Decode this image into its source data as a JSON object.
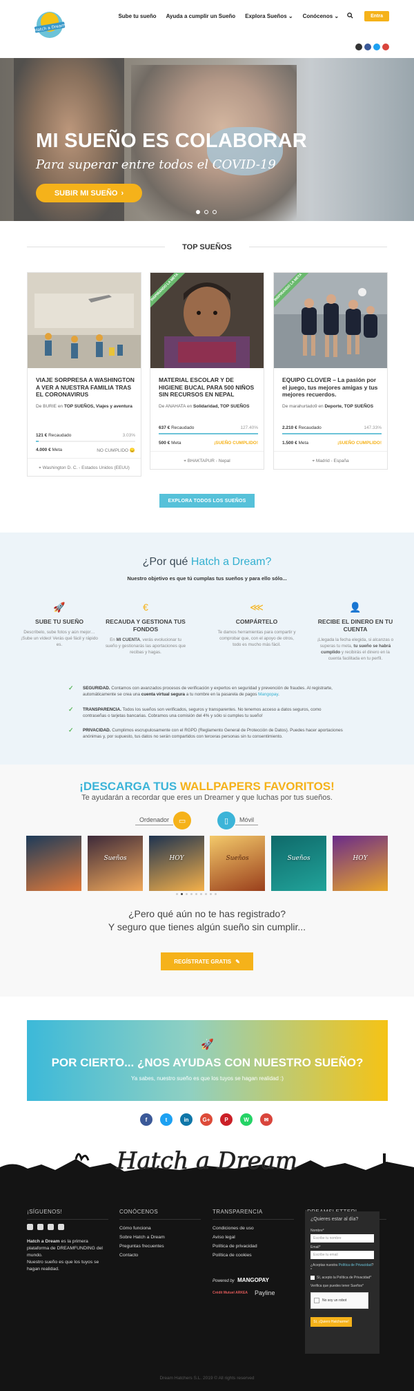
{
  "header": {
    "logo_text": "Hatch a Dream",
    "nav": [
      {
        "label": "Sube tu sueño"
      },
      {
        "label": "Ayuda a cumplir un Sueño"
      },
      {
        "label": "Explora Sueños"
      },
      {
        "label": "Conócenos"
      }
    ],
    "login_label": "Entra",
    "social": [
      "instagram-icon",
      "facebook-icon",
      "twitter-icon",
      "youtube-icon"
    ]
  },
  "hero": {
    "title": "MI SUEÑO ES COLABORAR",
    "subtitle": "Para superar entre todos el COVID-19",
    "cta": "SUBIR MI SUEÑO"
  },
  "top": {
    "title": "TOP SUEÑOS",
    "cards": [
      {
        "title": "VIAJE SORPRESA A WASHINGTON A VER A NUESTRA FAMILIA TRAS EL CORONAVIRUS",
        "by_prefix": "De",
        "author": "BURIE",
        "in": "en",
        "categories": "TOP SUEÑOS, Viajes y aventura",
        "raised": "121 €",
        "raised_label": "Recaudado",
        "pct": "3.03%",
        "progress": 0.0303,
        "goal": "4.000 €",
        "goal_label": "Meta",
        "status": "NO CUMPLIDO 😞",
        "location": "Washington D. C. - Estados Unidos (EEUU)",
        "ribbon": ""
      },
      {
        "title": "MATERIAL ESCOLAR Y DE HIGIENE BUCAL PARA 500 NIÑOS SIN RECURSOS EN NEPAL",
        "by_prefix": "De",
        "author": "ANAHATA",
        "in": "en",
        "categories": "Solidaridad, TOP SUEÑOS",
        "raised": "637 €",
        "raised_label": "Recaudado",
        "pct": "127.40%",
        "progress": 1.0,
        "goal": "500 €",
        "goal_label": "Meta",
        "status": "¡SUEÑO CUMPLIDO!",
        "location": "BHAKTAPUR - Nepal",
        "ribbon": "INSPIRANDO LA META"
      },
      {
        "title": "EQUIPO CLOVER – La pasión por el juego, tus mejores amigas y tus mejores recuerdos.",
        "by_prefix": "De",
        "author": "marahurtado9",
        "in": "en",
        "categories": "Deporte, TOP SUEÑOS",
        "raised": "2.210 €",
        "raised_label": "Recaudado",
        "pct": "147.33%",
        "progress": 1.0,
        "goal": "1.500 €",
        "goal_label": "Meta",
        "status": "¡SUEÑO CUMPLIDO!",
        "location": "Madrid - España",
        "ribbon": "INSPIRANDO LA META"
      }
    ],
    "explore": "EXPLORA TODOS LOS SUEÑOS"
  },
  "why": {
    "title_a": "¿Por qué",
    "title_b": "Hatch a Dream?",
    "intro": "Nuestro objetivo es que tú cumplas tus sueños y para ello sólo...",
    "features": [
      {
        "icon": "rocket-icon",
        "title": "SUBE TU SUEÑO",
        "text": "Descríbelo, sube fotos y aún mejor… ¡Sube un vídeo! Verás qué fácil y rápido es."
      },
      {
        "icon": "euro-icon",
        "title": "RECAUDA Y GESTIONA TUS FONDOS",
        "text_a": "En",
        "text_b": "MI CUENTA",
        "text_c": ", verás evolucionar tu sueño y gestionarás las aportaciones que recibas y hagas."
      },
      {
        "icon": "share-icon",
        "title": "COMPÁRTELO",
        "text": "Te damos herramientas para compartir y comprobar que, con el apoyo de otros, todo es mucho más fácil."
      },
      {
        "icon": "user-money-icon",
        "title": "RECIBE EL DINERO EN TU CUENTA",
        "text_a": "¡Llegada la fecha elegida, si alcanzas o superas tu meta,",
        "text_b": "tu sueño se habrá cumplido",
        "text_c": "y recibirás el dinero en la cuenta facilitada en tu perfil."
      }
    ],
    "checks": [
      {
        "head": "SEGURIDAD.",
        "text_a": "Contamos con avanzados procesos de verificación y expertos en seguridad y prevención de fraudes. Al registrarte, automáticamente se crea una",
        "bold": "cuenta virtual segura",
        "text_b": "a tu nombre en la pasarela de pagos",
        "link": "Mangopay",
        "text_c": "."
      },
      {
        "head": "TRANSPARENCIA.",
        "text_a": "Todos los sueños son verificados, seguros y transparentes. No tenemos acceso a datos seguros, como contraseñas o tarjetas bancarias. Cobramos una comisión del 4% y sólo si cumples tu sueño!"
      },
      {
        "head": "PRIVACIDAD.",
        "text_a": "Cumplimos escrupulosamente con el RGPD (Reglamento General de Protección de Datos). Puedes hacer aportaciones anónimas y, por supuesto, tus datos no serán compartidos con terceras personas sin tu consentimiento."
      }
    ]
  },
  "wallpapers": {
    "title_a": "¡DESCARGA TUS",
    "title_b": "WALLPAPERS FAVORITOS!",
    "intro": "Te ayudarán a recordar que eres un Dreamer y que luchas por tus sueños.",
    "desktop": "Ordenador",
    "mobile": "Móvil",
    "thumbs": [
      {
        "text": "",
        "c1": "#1d3b5a",
        "c2": "#e07a3a"
      },
      {
        "text": "Sueños",
        "c1": "#3d2a3a",
        "c2": "#f0a85a"
      },
      {
        "text": "HOY",
        "c1": "#1e3350",
        "c2": "#f4b04a"
      },
      {
        "text": "Sueños",
        "c1": "#f3c96a",
        "c2": "#9a3f1c"
      },
      {
        "text": "Sueños",
        "c1": "#0f6a6a",
        "c2": "#21a39a"
      },
      {
        "text": "HOY",
        "c1": "#6a2b8a",
        "c2": "#e9a62a"
      }
    ],
    "question_1": "¿Pero qué aún no te has registrado?",
    "question_2": "Y seguro que tienes algún sueño sin cumplir...",
    "register": "REGÍSTRATE GRATIS"
  },
  "help": {
    "title": "POR CIERTO... ¿NOS AYUDAS CON NUESTRO SUEÑO?",
    "text": "Ya sabes, nuestro sueño es que los tuyos se hagan realidad :)"
  },
  "share": [
    {
      "icon": "facebook-icon",
      "glyph": "f",
      "color": "#3b5998"
    },
    {
      "icon": "twitter-icon",
      "glyph": "t",
      "color": "#1da1f2"
    },
    {
      "icon": "linkedin-icon",
      "glyph": "in",
      "color": "#0e76a8"
    },
    {
      "icon": "googleplus-icon",
      "glyph": "G+",
      "color": "#dd4b39"
    },
    {
      "icon": "pinterest-icon",
      "glyph": "P",
      "color": "#cb2027"
    },
    {
      "icon": "whatsapp-icon",
      "glyph": "W",
      "color": "#25d366"
    },
    {
      "icon": "email-icon",
      "glyph": "✉",
      "color": "#d9453c"
    }
  ],
  "footer": {
    "brand": "Hatch a Dream",
    "follow": "¡SÍGUENOS!",
    "about_a": "Hatch a Dream",
    "about_b": "es la primera plataforma de DREAMFUNDING del mundo.",
    "about_c": "Nuestro sueño es que los tuyos se hagan realidad.",
    "know_title": "CONÓCENOS",
    "know_links": [
      "Cómo funciona",
      "Sobre Hatch a Dream",
      "Preguntas frecuentes",
      "Contacto"
    ],
    "trans_title": "TRANSPARENCIA",
    "trans_links": [
      "Condiciones de uso",
      "Aviso legal",
      "Política de privacidad",
      "Política de cookies"
    ],
    "powered": "Powered by",
    "mangopay": "MANGOPAY",
    "cm": "Crédit Mutuel ARKEA",
    "payline": "Payline",
    "news_title": "¡DREAMSLETTER!",
    "form": {
      "title": "¿Quieres estar al día?",
      "name_label": "Nombre*",
      "name_ph": "Escribe tu nombre",
      "email_label": "Email*",
      "email_ph": "Escribe tu email",
      "privacy_a": "¿Aceptas nuestra",
      "privacy_link": "Política de Privacidad",
      "privacy_b": "?*",
      "accept": "Sí, acepto la Política de Privacidad*",
      "verify": "Verifica que puedes tener Sueños*",
      "captcha": "No soy un robot",
      "submit": "Sí, ¡Quiero Hatcharme!"
    },
    "copyright": "Dream Hatchers S.L. 2019 © All rights reserved"
  }
}
